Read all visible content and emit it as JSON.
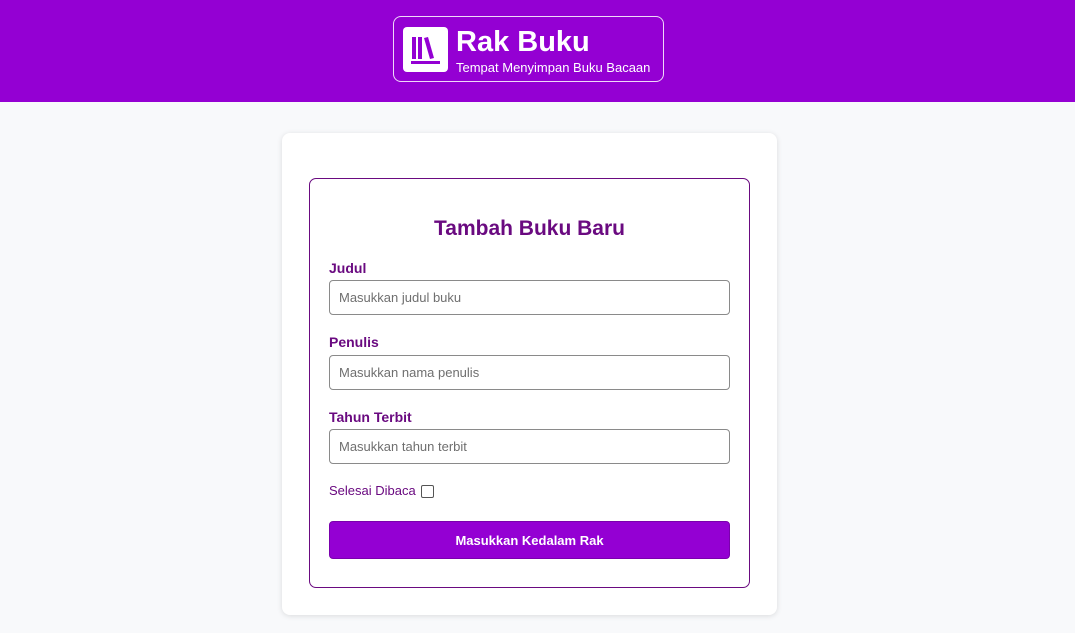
{
  "header": {
    "title": "Rak Buku",
    "subtitle": "Tempat Menyimpan Buku Bacaan",
    "logo_icon": "books-icon",
    "background": "#9400d3"
  },
  "form": {
    "title": "Tambah Buku Baru",
    "fields": [
      {
        "label": "Judul",
        "placeholder": "Masukkan judul buku",
        "value": ""
      },
      {
        "label": "Penulis",
        "placeholder": "Masukkan nama penulis",
        "value": ""
      },
      {
        "label": "Tahun Terbit",
        "placeholder": "Masukkan tahun terbit",
        "value": ""
      }
    ],
    "checkbox": {
      "label": "Selesai Dibaca",
      "checked": false
    },
    "submit_label": "Masukkan Kedalam Rak",
    "accent": "#6a0a80"
  }
}
